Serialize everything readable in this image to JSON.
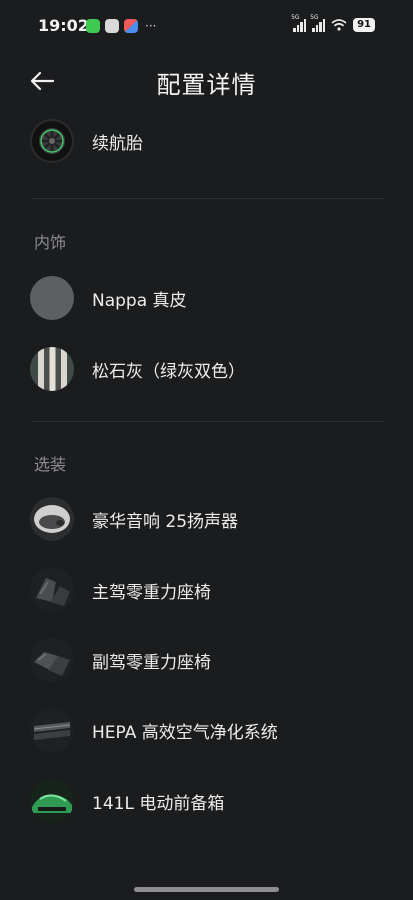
{
  "status_bar": {
    "time": "19:02",
    "signal_1_label": "5G",
    "signal_2_label": "5G",
    "battery": "91"
  },
  "header": {
    "title": "配置详情"
  },
  "top_item": {
    "label": "续航胎",
    "icon": "tire-thumbnail"
  },
  "interior": {
    "title": "内饰",
    "items": [
      {
        "label": "Nappa 真皮",
        "icon": "leather-swatch"
      },
      {
        "label": "松石灰（绿灰双色）",
        "icon": "color-stripes-swatch"
      }
    ]
  },
  "options": {
    "title": "选装",
    "items": [
      {
        "label": "豪华音响 25扬声器",
        "icon": "speaker-thumbnail"
      },
      {
        "label": "主驾零重力座椅",
        "icon": "driver-seat-thumbnail"
      },
      {
        "label": "副驾零重力座椅",
        "icon": "passenger-seat-thumbnail"
      },
      {
        "label": "HEPA 高效空气净化系统",
        "icon": "air-filter-thumbnail"
      },
      {
        "label": "141L 电动前备箱",
        "icon": "frunk-thumbnail"
      }
    ]
  },
  "colors": {
    "background": "#1b1c1e",
    "accent_green": "#3fc46a",
    "section_title": "#8c8d90"
  }
}
